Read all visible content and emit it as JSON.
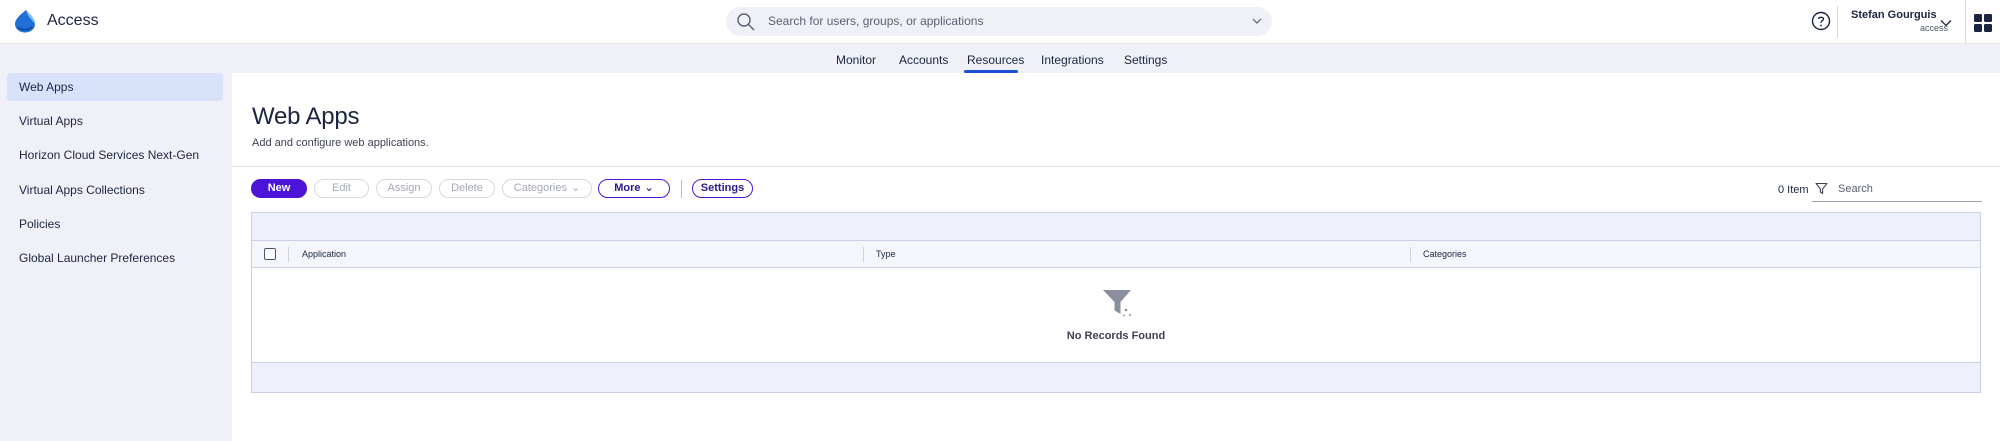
{
  "header": {
    "app_name": "Access",
    "search_placeholder": "Search for users, groups, or applications",
    "user_name": "Stefan Gourguis",
    "user_org": "access"
  },
  "nav": {
    "tabs": [
      {
        "label": "Monitor"
      },
      {
        "label": "Accounts"
      },
      {
        "label": "Resources",
        "active": true
      },
      {
        "label": "Integrations"
      },
      {
        "label": "Settings"
      }
    ]
  },
  "sidebar": {
    "items": [
      {
        "label": "Web Apps",
        "active": true
      },
      {
        "label": "Virtual Apps"
      },
      {
        "label": "Horizon Cloud Services Next-Gen"
      },
      {
        "label": "Virtual Apps Collections"
      },
      {
        "label": "Policies"
      },
      {
        "label": "Global Launcher Preferences"
      }
    ]
  },
  "main": {
    "title": "Web Apps",
    "subtitle": "Add and configure web applications."
  },
  "toolbar": {
    "new_label": "New",
    "edit_label": "Edit",
    "assign_label": "Assign",
    "delete_label": "Delete",
    "categories_label": "Categories",
    "more_label": "More",
    "settings_label": "Settings",
    "item_count": "0 Item",
    "search_placeholder": "Search"
  },
  "table": {
    "columns": [
      "Application",
      "Type",
      "Categories"
    ],
    "empty_text": "No Records Found"
  },
  "colors": {
    "accent": "#4b14d8",
    "nav_underline": "#1a4fd6",
    "sidebar_active": "#d8e2fa"
  }
}
